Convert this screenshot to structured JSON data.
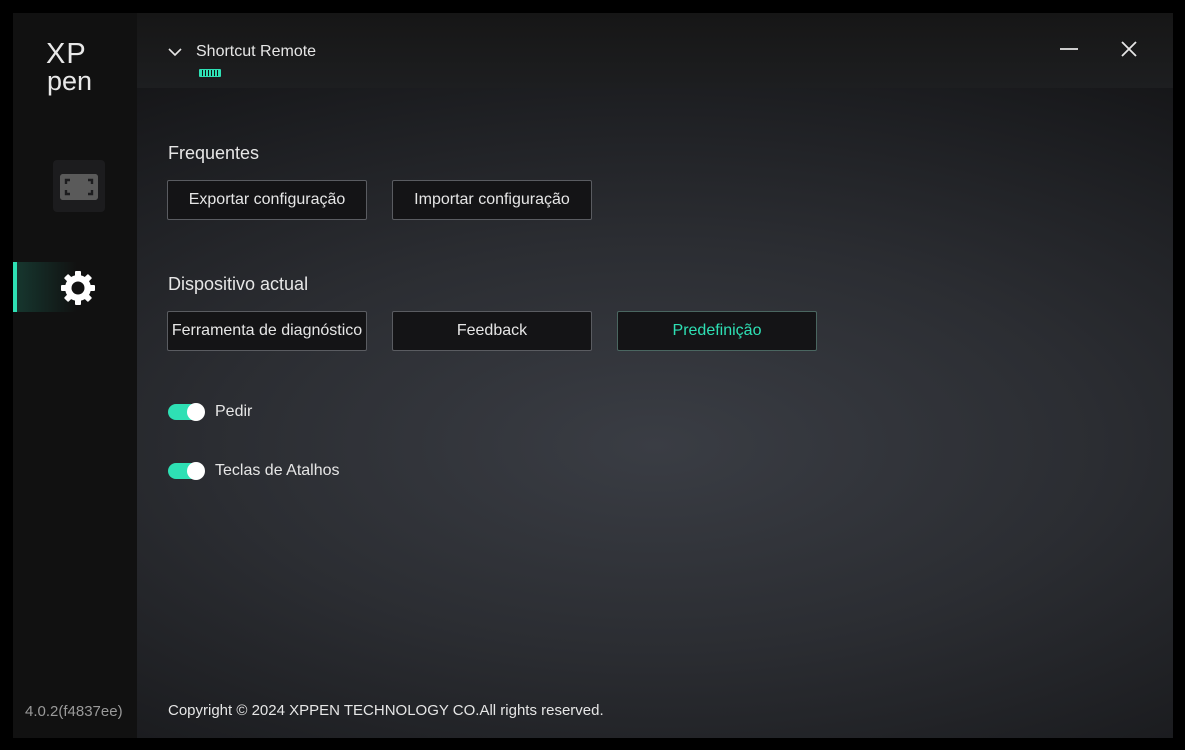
{
  "sidebar": {
    "logo": {
      "line1": "XP",
      "line2": "pen"
    },
    "items": [
      {
        "name": "device",
        "icon": "screen-frame-icon"
      },
      {
        "name": "settings",
        "icon": "gear-icon",
        "active": true
      }
    ],
    "version": "4.0.2(f4837ee)"
  },
  "titlebar": {
    "device_name": "Shortcut Remote",
    "battery_icon": "battery-icon",
    "minimize_icon": "minimize-icon",
    "close_icon": "close-icon"
  },
  "main": {
    "frequent": {
      "title": "Frequentes",
      "export_label": "Exportar configuração",
      "import_label": "Importar configuração"
    },
    "current_device": {
      "title": "Dispositivo actual",
      "diagnostic_label": "Ferramenta de diagnóstico",
      "feedback_label": "Feedback",
      "default_label": "Predefinição"
    },
    "toggles": [
      {
        "label": "Pedir",
        "on": true
      },
      {
        "label": "Teclas de Atalhos",
        "on": true
      }
    ],
    "copyright": "Copyright © 2024  XPPEN TECHNOLOGY CO.All rights reserved."
  },
  "colors": {
    "accent": "#2ee0b4",
    "background": "#2b2d32",
    "sidebar": "#111111"
  }
}
